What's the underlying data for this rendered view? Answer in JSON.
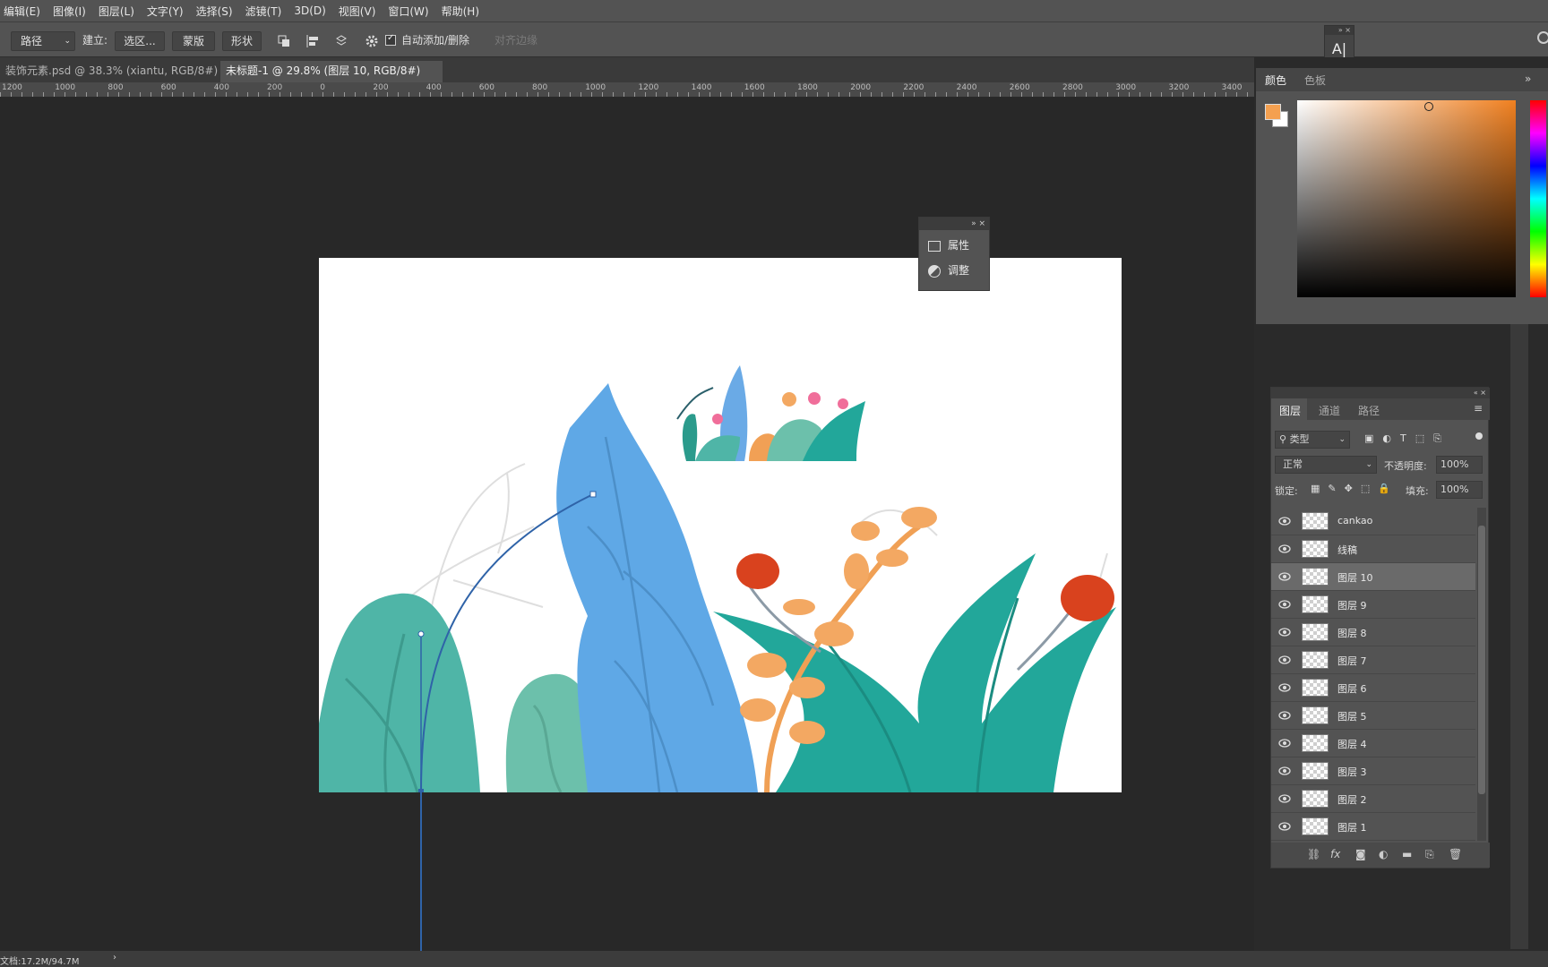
{
  "menu": [
    "编辑(E)",
    "图像(I)",
    "图层(L)",
    "文字(Y)",
    "选择(S)",
    "滤镜(T)",
    "3D(D)",
    "视图(V)",
    "窗口(W)",
    "帮助(H)"
  ],
  "options": {
    "mode_select": "路径",
    "build_label": "建立:",
    "selection_btn": "选区...",
    "mask_btn": "蒙版",
    "shape_btn": "形状",
    "auto_add_delete": "自动添加/删除",
    "align_edges": "对齐边缘"
  },
  "tabs": [
    {
      "label": "装饰元素.psd @ 38.3% (xiantu, RGB/8#) *",
      "close": "×"
    },
    {
      "label": "未标题-1 @ 29.8% (图层 10, RGB/8#) *",
      "close": "×"
    }
  ],
  "ruler_labels": [
    "1200",
    "1000",
    "800",
    "600",
    "400",
    "200",
    "0",
    "200",
    "400",
    "600",
    "800",
    "1000",
    "1200",
    "1400",
    "1600",
    "1800",
    "2000",
    "2200",
    "2400",
    "2600",
    "2800",
    "3000",
    "3200",
    "3400"
  ],
  "float_panel": {
    "items": [
      {
        "label": "属性",
        "icon": "properties-icon"
      },
      {
        "label": "调整",
        "icon": "adjustments-icon"
      }
    ]
  },
  "char_panel_icon": "type-tool-icon",
  "color_panel": {
    "tabs": [
      "颜色",
      "色板"
    ],
    "foreground": "#f4a050",
    "background": "#ffffff",
    "hue_base": "#f08020"
  },
  "layers_panel": {
    "tabs": [
      "图层",
      "通道",
      "路径"
    ],
    "filter_kind": "类型",
    "blend_mode": "正常",
    "opacity_label": "不透明度:",
    "opacity_value": "100%",
    "lock_label": "锁定:",
    "fill_label": "填充:",
    "fill_value": "100%",
    "layers": [
      {
        "name": "cankao",
        "selected": false
      },
      {
        "name": "线稿",
        "selected": false
      },
      {
        "name": "图层 10",
        "selected": true
      },
      {
        "name": "图层 9",
        "selected": false
      },
      {
        "name": "图层 8",
        "selected": false
      },
      {
        "name": "图层 7",
        "selected": false
      },
      {
        "name": "图层 6",
        "selected": false
      },
      {
        "name": "图层 5",
        "selected": false
      },
      {
        "name": "图层 4",
        "selected": false
      },
      {
        "name": "图层 3",
        "selected": false
      },
      {
        "name": "图层 2",
        "selected": false
      },
      {
        "name": "图层 1",
        "selected": false
      }
    ],
    "footer_icons": [
      "link-icon",
      "fx-icon",
      "mask-icon",
      "adjustment-layer-icon",
      "group-icon",
      "new-layer-icon",
      "trash-icon"
    ]
  },
  "status": {
    "doc": "文档:17.2M/94.7M",
    "arrow": "›"
  }
}
